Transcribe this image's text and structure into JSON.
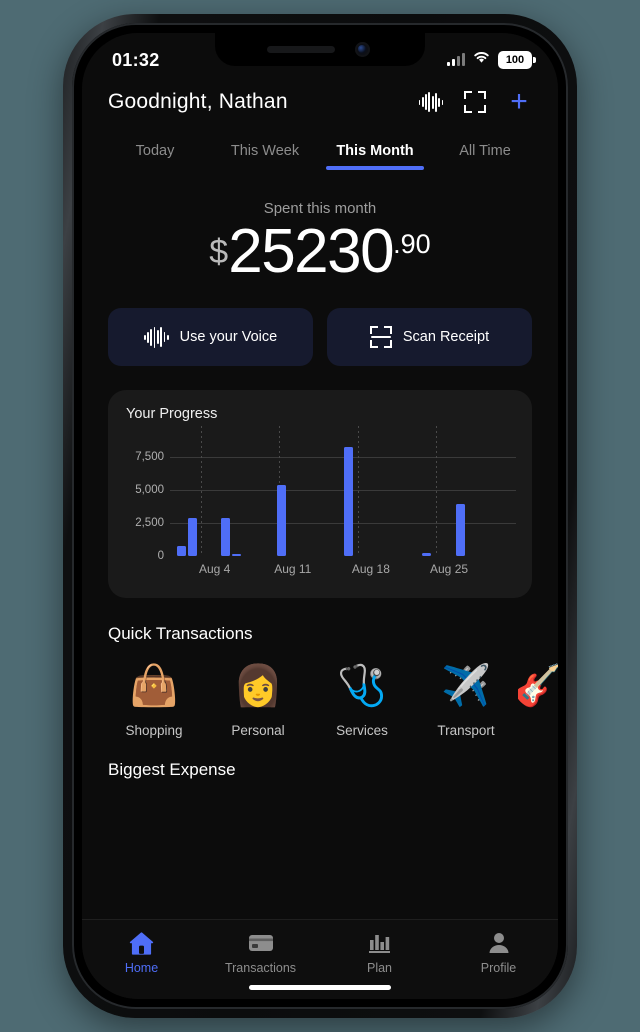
{
  "statusbar": {
    "clock": "01:32",
    "battery": "100",
    "signal_icon": "cellular-signal-icon",
    "wifi_icon": "wifi-icon",
    "battery_icon": "battery-icon"
  },
  "header": {
    "greeting": "Goodnight, Nathan",
    "voice_icon": "voice-waveform-icon",
    "scan_icon": "scan-receipt-icon",
    "add_icon": "plus-icon",
    "add_label": "+"
  },
  "tabs": [
    {
      "label": "Today",
      "active": false
    },
    {
      "label": "This Week",
      "active": false
    },
    {
      "label": "This Month",
      "active": true
    },
    {
      "label": "All Time",
      "active": false
    }
  ],
  "summary": {
    "label": "Spent this month",
    "currency": "$",
    "integer": "25230",
    "decimal": ".90",
    "amount": 25230.9
  },
  "actions": [
    {
      "label": "Use your Voice",
      "icon": "voice-waveform-icon"
    },
    {
      "label": "Scan Receipt",
      "icon": "scan-receipt-icon"
    }
  ],
  "progress_card": {
    "title": "Your Progress"
  },
  "chart_data": {
    "type": "bar",
    "title": "Your Progress",
    "xlabel": "",
    "ylabel": "",
    "ylim": [
      0,
      8800
    ],
    "grid": true,
    "legend": false,
    "ytick_labels": [
      "0",
      "2,500",
      "5,000",
      "7,500"
    ],
    "ytick_values": [
      0,
      2500,
      5000,
      7500
    ],
    "xtick_labels": [
      "Aug 4",
      "Aug 11",
      "Aug 18",
      "Aug 25"
    ],
    "xtick_positions": [
      4,
      11,
      18,
      25
    ],
    "bar_color": "#4f6ef7",
    "x": [
      1,
      2,
      5,
      6,
      10,
      16,
      23,
      26,
      30
    ],
    "values": [
      800,
      2900,
      2900,
      150,
      5400,
      8300,
      200,
      3950,
      0
    ],
    "bars": [
      {
        "day": 1,
        "value": 800
      },
      {
        "day": 2,
        "value": 2900
      },
      {
        "day": 5,
        "value": 2900
      },
      {
        "day": 6,
        "value": 150
      },
      {
        "day": 10,
        "value": 5400
      },
      {
        "day": 16,
        "value": 8300
      },
      {
        "day": 23,
        "value": 200
      },
      {
        "day": 26,
        "value": 3950
      }
    ]
  },
  "quick_transactions": {
    "title": "Quick Transactions",
    "items": [
      {
        "label": "Shopping",
        "emoji": "👜",
        "icon": "shopping-bag-icon"
      },
      {
        "label": "Personal",
        "emoji": "👩",
        "icon": "person-avatar-icon"
      },
      {
        "label": "Services",
        "emoji": "🩺",
        "icon": "medical-services-icon"
      },
      {
        "label": "Transport",
        "emoji": "✈️",
        "icon": "airplane-icon"
      },
      {
        "label": "",
        "emoji": "🎸",
        "icon": "partial-item-icon"
      }
    ]
  },
  "biggest_expense": {
    "title": "Biggest Expense"
  },
  "bottom_nav": [
    {
      "label": "Home",
      "icon": "home-icon",
      "active": true
    },
    {
      "label": "Transactions",
      "icon": "credit-card-icon",
      "active": false
    },
    {
      "label": "Plan",
      "icon": "bar-chart-icon",
      "active": false
    },
    {
      "label": "Profile",
      "icon": "person-icon",
      "active": false
    }
  ],
  "colors": {
    "accent": "#4f6ef7",
    "background": "#0c0c0c",
    "card": "#1a1a1a",
    "scene": "#4e6b73"
  }
}
